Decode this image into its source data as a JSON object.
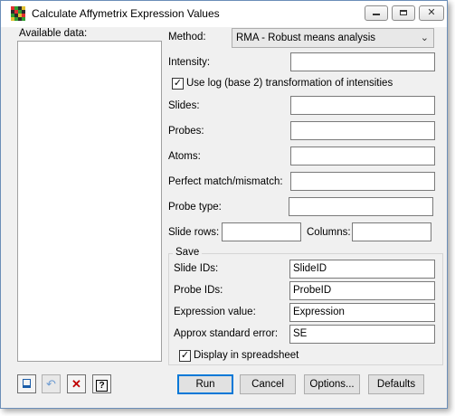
{
  "window": {
    "title": "Calculate Affymetrix Expression Values"
  },
  "left": {
    "available_label": "Available data:"
  },
  "form": {
    "method_label": "Method:",
    "method_value": "RMA - Robust means analysis",
    "intensity_label": "Intensity:",
    "log_check_label": "Use log (base 2) transformation of intensities",
    "slides_label": "Slides:",
    "probes_label": "Probes:",
    "atoms_label": "Atoms:",
    "pm_label": "Perfect match/mismatch:",
    "probe_type_label": "Probe type:",
    "slide_rows_label": "Slide rows:",
    "columns_label": "Columns:"
  },
  "save": {
    "legend": "Save",
    "slide_ids_label": "Slide IDs:",
    "slide_ids_value": "SlideID",
    "probe_ids_label": "Probe IDs:",
    "probe_ids_value": "ProbeID",
    "expr_label": "Expression value:",
    "expr_value": "Expression",
    "se_label": "Approx standard error:",
    "se_value": "SE",
    "spreadsheet_label": "Display in spreadsheet"
  },
  "buttons": {
    "run": "Run",
    "cancel": "Cancel",
    "options": "Options...",
    "defaults": "Defaults"
  },
  "checks": {
    "log_checked": "✓",
    "spreadsheet_checked": "✓"
  },
  "icons": {
    "window_min": "▭",
    "window_max": "☐",
    "window_close": "✕",
    "help": "?",
    "clear": "✕",
    "undo": "↶",
    "pin": "📌",
    "chevron": "⌄"
  },
  "colors": {
    "accent": "#0078d7",
    "clear_red": "#c00000"
  }
}
